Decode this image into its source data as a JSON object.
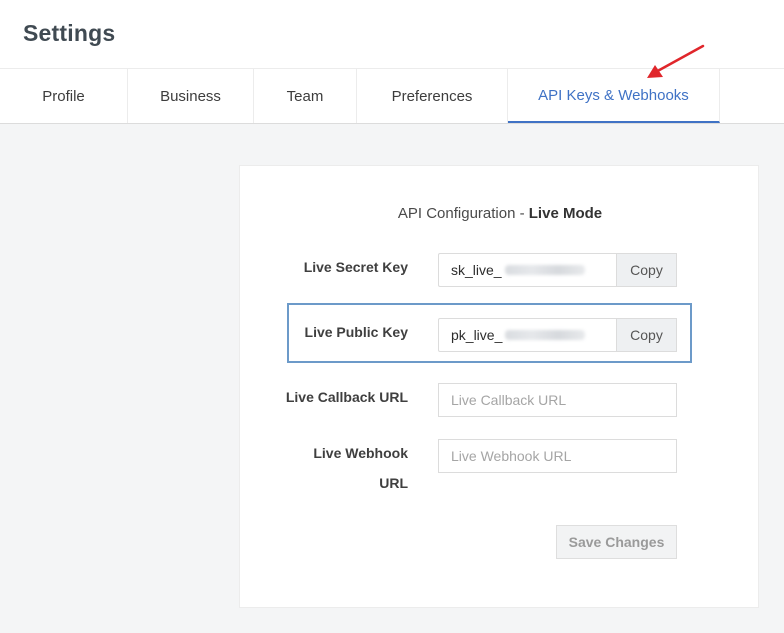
{
  "page": {
    "title": "Settings"
  },
  "tabs": [
    {
      "label": "Profile"
    },
    {
      "label": "Business"
    },
    {
      "label": "Team"
    },
    {
      "label": "Preferences"
    },
    {
      "label": "API Keys & Webhooks",
      "active": true
    }
  ],
  "card": {
    "title_prefix": "API Configuration - ",
    "title_mode": "Live Mode",
    "secret_key": {
      "label": "Live Secret Key",
      "value": "sk_live_",
      "copy_label": "Copy"
    },
    "public_key": {
      "label": "Live Public Key",
      "value": "pk_live_",
      "copy_label": "Copy"
    },
    "callback_url": {
      "label": "Live Callback URL",
      "placeholder": "Live Callback URL"
    },
    "webhook_url": {
      "label_line1": "Live Webhook",
      "label_line2": "URL",
      "placeholder": "Live Webhook URL"
    },
    "save_label": "Save Changes"
  },
  "colors": {
    "accent": "#3f72c5",
    "annotation_arrow": "#e0262b",
    "highlight_border": "#6c9ac9"
  }
}
